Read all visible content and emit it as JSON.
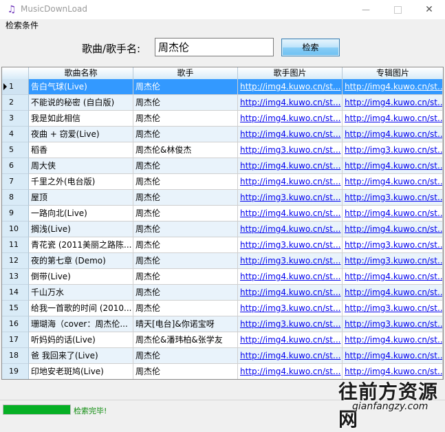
{
  "window": {
    "title": "MusicDownLoad",
    "minimize_glyph": "—",
    "close_glyph": "✕"
  },
  "search": {
    "group_label": "检索条件",
    "field_label": "歌曲/歌手名:",
    "value": "周杰伦",
    "button_label": "检索"
  },
  "grid": {
    "columns": [
      "歌曲名称",
      "歌手",
      "歌手图片",
      "专辑图片"
    ],
    "selected_row": 1,
    "rows": [
      {
        "no": "1",
        "song": "告白气球(Live)",
        "singer": "周杰伦",
        "singer_img": "http://img4.kuwo.cn/st...",
        "album_img": "http://img4.kuwo.cn/st..."
      },
      {
        "no": "2",
        "song": "不能说的秘密 (自白版)",
        "singer": "周杰伦",
        "singer_img": "http://img4.kuwo.cn/st...",
        "album_img": "http://img4.kuwo.cn/st..."
      },
      {
        "no": "3",
        "song": "我是如此相信",
        "singer": "周杰伦",
        "singer_img": "http://img4.kuwo.cn/st...",
        "album_img": "http://img4.kuwo.cn/st..."
      },
      {
        "no": "4",
        "song": "夜曲 + 窃爱(Live)",
        "singer": "周杰伦",
        "singer_img": "http://img4.kuwo.cn/st...",
        "album_img": "http://img4.kuwo.cn/st..."
      },
      {
        "no": "5",
        "song": "稻香",
        "singer": "周杰伦&林俊杰",
        "singer_img": "http://img3.kuwo.cn/st...",
        "album_img": "http://img3.kuwo.cn/st..."
      },
      {
        "no": "6",
        "song": "周大侠",
        "singer": "周杰伦",
        "singer_img": "http://img4.kuwo.cn/st...",
        "album_img": "http://img4.kuwo.cn/st..."
      },
      {
        "no": "7",
        "song": "千里之外(电台版)",
        "singer": "周杰伦",
        "singer_img": "http://img4.kuwo.cn/st...",
        "album_img": "http://img4.kuwo.cn/st..."
      },
      {
        "no": "8",
        "song": "屋顶",
        "singer": "周杰伦",
        "singer_img": "http://img3.kuwo.cn/st...",
        "album_img": "http://img3.kuwo.cn/st..."
      },
      {
        "no": "9",
        "song": "一路向北(Live)",
        "singer": "周杰伦",
        "singer_img": "http://img4.kuwo.cn/st...",
        "album_img": "http://img4.kuwo.cn/st..."
      },
      {
        "no": "10",
        "song": "搁浅(Live)",
        "singer": "周杰伦",
        "singer_img": "http://img4.kuwo.cn/st...",
        "album_img": "http://img4.kuwo.cn/st..."
      },
      {
        "no": "11",
        "song": "青花瓷 (2011美丽之路陈...",
        "singer": "周杰伦",
        "singer_img": "http://img3.kuwo.cn/st...",
        "album_img": "http://img3.kuwo.cn/st..."
      },
      {
        "no": "12",
        "song": "夜的第七章 (Demo)",
        "singer": "周杰伦",
        "singer_img": "http://img3.kuwo.cn/st...",
        "album_img": "http://img3.kuwo.cn/st..."
      },
      {
        "no": "13",
        "song": "倒带(Live)",
        "singer": "周杰伦",
        "singer_img": "http://img4.kuwo.cn/st...",
        "album_img": "http://img4.kuwo.cn/st..."
      },
      {
        "no": "14",
        "song": "千山万水",
        "singer": "周杰伦",
        "singer_img": "http://img4.kuwo.cn/st...",
        "album_img": "http://img4.kuwo.cn/st..."
      },
      {
        "no": "15",
        "song": "给我一首歌的时间 (2010...",
        "singer": "周杰伦",
        "singer_img": "http://img3.kuwo.cn/st...",
        "album_img": "http://img3.kuwo.cn/st..."
      },
      {
        "no": "16",
        "song": "珊瑚海（cover：周杰伦...",
        "singer": "晴天[电台]&你诺宝呀",
        "singer_img": "http://img3.kuwo.cn/st...",
        "album_img": "http://img3.kuwo.cn/st..."
      },
      {
        "no": "17",
        "song": "听妈妈的话(Live)",
        "singer": "周杰伦&潘玮柏&张学友",
        "singer_img": "http://img4.kuwo.cn/st...",
        "album_img": "http://img4.kuwo.cn/st..."
      },
      {
        "no": "18",
        "song": "爸 我回来了(Live)",
        "singer": "周杰伦",
        "singer_img": "http://img4.kuwo.cn/st...",
        "album_img": "http://img4.kuwo.cn/st..."
      },
      {
        "no": "19",
        "song": "印地安老斑鸠(Live)",
        "singer": "周杰伦",
        "singer_img": "http://img4.kuwo.cn/st...",
        "album_img": "http://img4.kuwo.cn/st..."
      }
    ]
  },
  "status": {
    "progress_fraction": 1.0,
    "text": "检索完毕!"
  },
  "watermark": {
    "main": "往前方资源网",
    "sub": "qianfangzy.com"
  },
  "colors": {
    "selection": "#3399ff",
    "link": "#0000ee",
    "progress": "#06b025",
    "status_text": "#0a8a0a"
  }
}
